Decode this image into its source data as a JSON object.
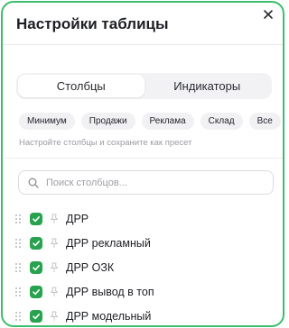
{
  "header": {
    "title": "Настройки таблицы"
  },
  "tabs": [
    {
      "label": "Столбцы",
      "active": true
    },
    {
      "label": "Индикаторы",
      "active": false
    }
  ],
  "presets": [
    "Минимум",
    "Продажи",
    "Реклама",
    "Склад",
    "Все"
  ],
  "hint": "Настройте столбцы и сохраните как пресет",
  "search": {
    "placeholder": "Поиск столбцов..."
  },
  "columns": [
    {
      "label": "ДРР",
      "checked": true
    },
    {
      "label": "ДРР рекламный",
      "checked": true
    },
    {
      "label": "ДРР ОЗК",
      "checked": true
    },
    {
      "label": "ДРР вывод в топ",
      "checked": true
    },
    {
      "label": "ДРР модельный",
      "checked": true
    }
  ],
  "colors": {
    "accent": "#27a34f",
    "border": "#3dbd6d"
  },
  "icons": {
    "close": "close-icon",
    "search": "search-icon",
    "grip": "drag-handle-icon",
    "pin": "pin-icon",
    "check": "check-icon"
  }
}
